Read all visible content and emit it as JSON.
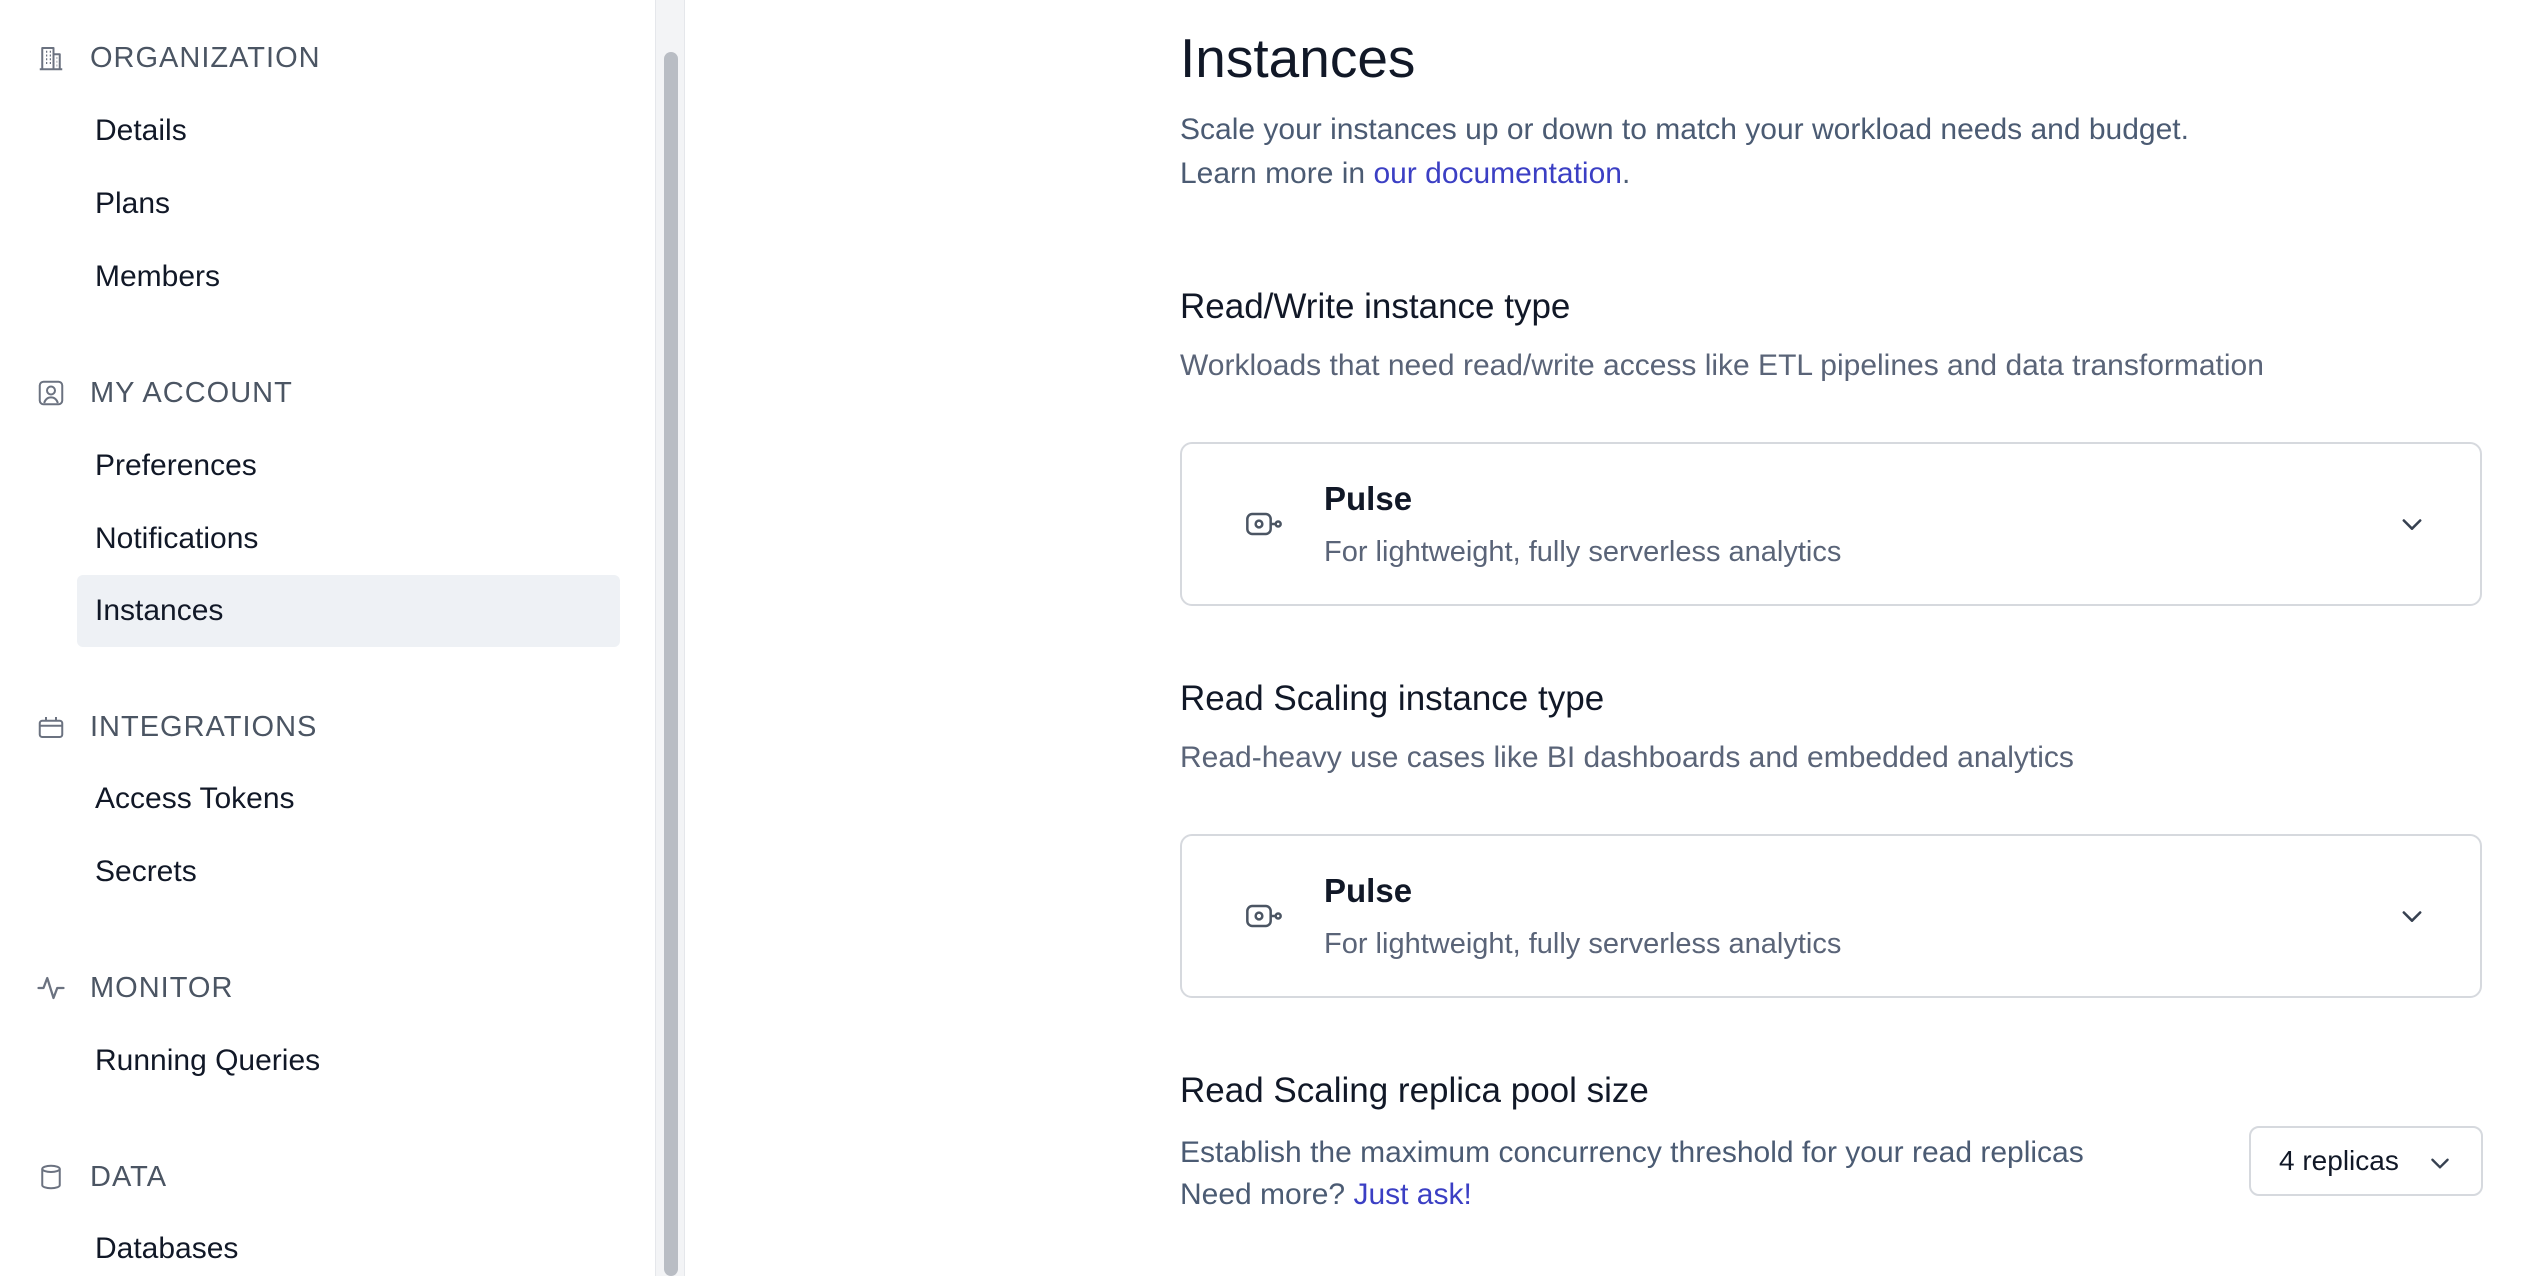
{
  "sidebar": {
    "sections": [
      {
        "label": "ORGANIZATION",
        "icon": "building-icon",
        "items": [
          {
            "label": "Details"
          },
          {
            "label": "Plans"
          },
          {
            "label": "Members"
          }
        ]
      },
      {
        "label": "MY ACCOUNT",
        "icon": "user-square-icon",
        "items": [
          {
            "label": "Preferences"
          },
          {
            "label": "Notifications"
          },
          {
            "label": "Instances",
            "active": true
          }
        ]
      },
      {
        "label": "INTEGRATIONS",
        "icon": "plug-icon",
        "items": [
          {
            "label": "Access Tokens"
          },
          {
            "label": "Secrets"
          }
        ]
      },
      {
        "label": "MONITOR",
        "icon": "activity-icon",
        "items": [
          {
            "label": "Running Queries"
          }
        ]
      },
      {
        "label": "DATA",
        "icon": "database-icon",
        "items": [
          {
            "label": "Databases"
          }
        ]
      }
    ]
  },
  "main": {
    "title": "Instances",
    "description_line1": "Scale your instances up or down to match your workload needs and budget.",
    "description_line2_prefix": "Learn more in ",
    "documentation_link": "our documentation",
    "description_line2_suffix": ".",
    "read_write": {
      "title": "Read/Write instance type",
      "subtitle": "Workloads that need read/write access like ETL pipelines and data transformation",
      "selected": {
        "name": "Pulse",
        "description": "For lightweight, fully serverless analytics",
        "icon": "pulse-instance-icon"
      }
    },
    "read_scaling": {
      "title": "Read Scaling instance type",
      "subtitle": "Read-heavy use cases like BI dashboards and embedded analytics",
      "selected": {
        "name": "Pulse",
        "description": "For lightweight, fully serverless analytics",
        "icon": "pulse-instance-icon"
      }
    },
    "replica_pool": {
      "title": "Read Scaling replica pool size",
      "description": "Establish the maximum concurrency threshold for your read replicas",
      "need_more_prefix": "Need more? ",
      "need_more_link": "Just ask!",
      "selected_value": "4 replicas"
    }
  },
  "colors": {
    "link": "#3b3fc4",
    "active_nav_bg": "#eef1f5",
    "muted_text": "#5a6478",
    "border": "#d6d9de"
  }
}
